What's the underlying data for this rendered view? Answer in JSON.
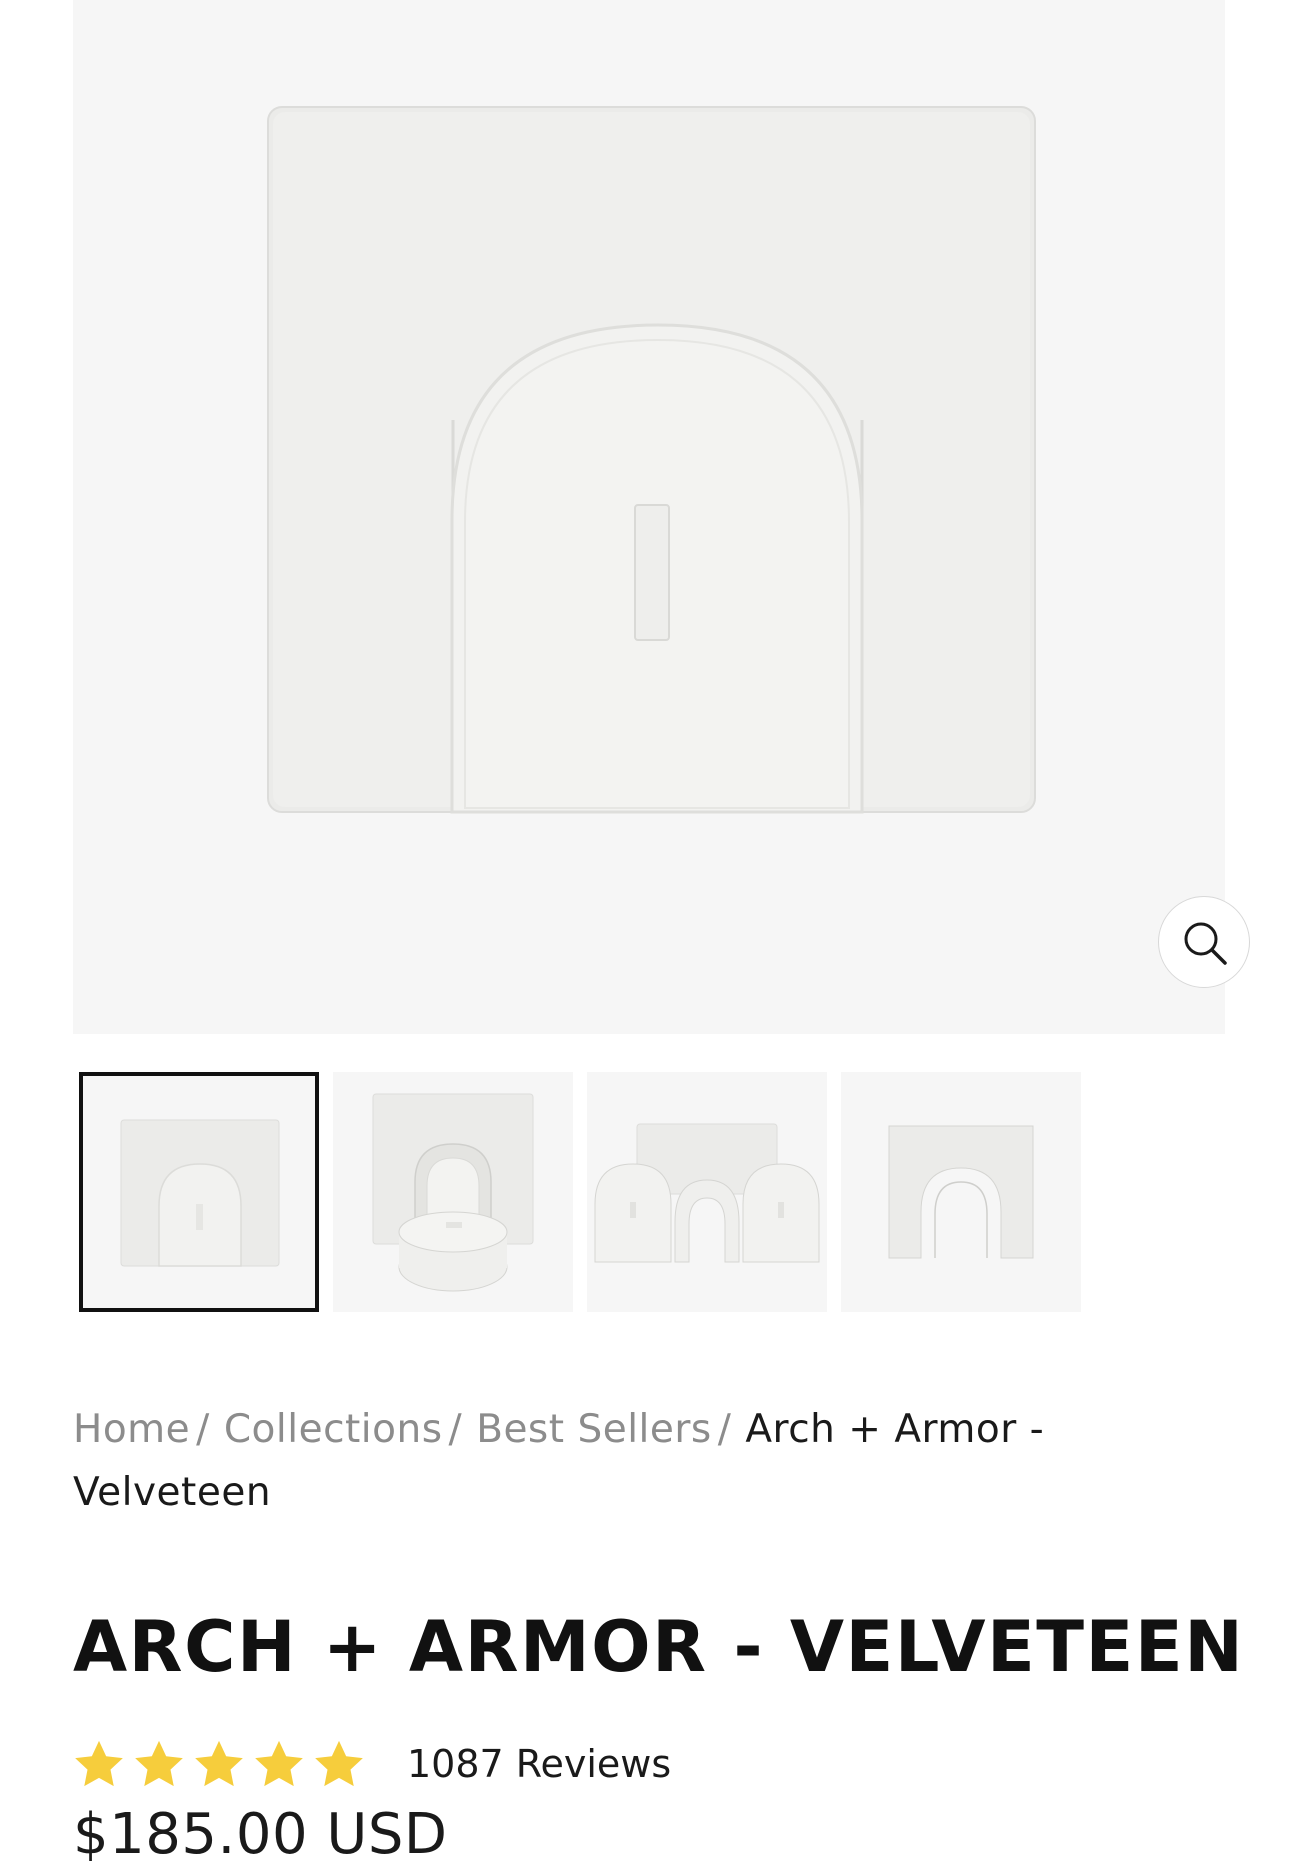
{
  "gallery": {
    "main_image_alt": "Arch + Armor - Velveteen main product photo",
    "zoom_icon": "magnifier-icon",
    "thumbnails": [
      {
        "alt": "Flat layout with arch",
        "active": true
      },
      {
        "alt": "Arch with cushion",
        "active": false
      },
      {
        "alt": "Double arch configuration",
        "active": false
      },
      {
        "alt": "Standing arch",
        "active": false
      }
    ]
  },
  "breadcrumb": {
    "items": [
      "Home",
      "Collections",
      "Best Sellers"
    ],
    "separator": "/",
    "current": "Arch + Armor - Velveteen"
  },
  "product": {
    "title": "ARCH + ARMOR - VELVETEEN",
    "rating": 5,
    "rating_max": 5,
    "reviews_label": "1087 Reviews",
    "price": "$185.00 USD"
  },
  "colors": {
    "star": "#f6cd3c",
    "image_bg": "#f6f6f6",
    "foam": "#efefed",
    "active_border": "#111111"
  }
}
